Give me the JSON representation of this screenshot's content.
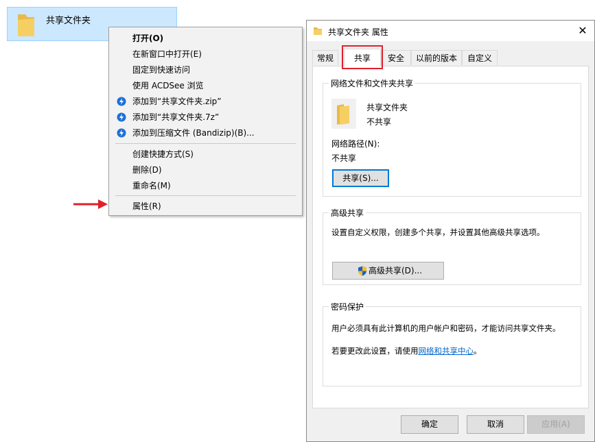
{
  "explorer": {
    "folder_name": "共享文件夹"
  },
  "context_menu": {
    "items": [
      {
        "label": "打开(O)"
      },
      {
        "label": "在新窗口中打开(E)"
      },
      {
        "label": "固定到快速访问"
      },
      {
        "label": "使用 ACDSee 浏览"
      },
      {
        "label": "添加到“共享文件夹.zip”"
      },
      {
        "label": "添加到“共享文件夹.7z”"
      },
      {
        "label": "添加到压缩文件 (Bandizip)(B)..."
      },
      {
        "label": "创建快捷方式(S)"
      },
      {
        "label": "删除(D)"
      },
      {
        "label": "重命名(M)"
      },
      {
        "label": "属性(R)"
      }
    ]
  },
  "dialog": {
    "title": "共享文件夹 属性",
    "tabs": [
      "常规",
      "共享",
      "安全",
      "以前的版本",
      "自定义"
    ],
    "network_sharing": {
      "group_title": "网络文件和文件夹共享",
      "folder_name": "共享文件夹",
      "share_status": "不共享",
      "network_path_label": "网络路径(N):",
      "network_path_value": "不共享",
      "share_button": "共享(S)..."
    },
    "advanced_sharing": {
      "group_title": "高级共享",
      "description": "设置自定义权限，创建多个共享，并设置其他高级共享选项。",
      "button": "高级共享(D)..."
    },
    "password_protection": {
      "group_title": "密码保护",
      "description": "用户必须具有此计算机的用户帐户和密码，才能访问共享文件夹。",
      "change_prefix": "若要更改此设置，请使用",
      "change_link": "网络和共享中心",
      "change_suffix": "。"
    },
    "buttons": {
      "ok": "确定",
      "cancel": "取消",
      "apply": "应用(A)"
    }
  },
  "colors": {
    "selection": "#cce8ff",
    "annotation_red": "#e0202a",
    "link": "#0066cc",
    "bandizip_blue": "#1e6fd9"
  }
}
